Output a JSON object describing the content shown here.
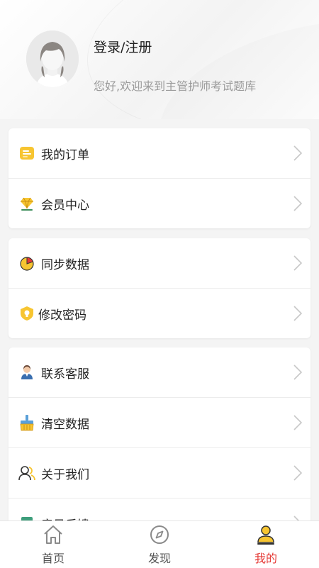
{
  "profile": {
    "login_label": "登录/注册",
    "welcome_text": "您好,欢迎来到主管护师考试题库"
  },
  "menu_groups": [
    {
      "items": [
        {
          "label": "我的订单",
          "icon": "order-icon"
        },
        {
          "label": "会员中心",
          "icon": "diamond-icon"
        }
      ]
    },
    {
      "items": [
        {
          "label": "同步数据",
          "icon": "sync-pie-icon"
        },
        {
          "label": "修改密码",
          "icon": "password-bulb-icon"
        }
      ]
    },
    {
      "items": [
        {
          "label": "联系客服",
          "icon": "customer-service-icon"
        },
        {
          "label": "清空数据",
          "icon": "clear-data-icon"
        },
        {
          "label": "关于我们",
          "icon": "about-us-icon"
        },
        {
          "label": "意见反馈",
          "icon": "feedback-icon"
        }
      ]
    }
  ],
  "tabbar": {
    "tabs": [
      {
        "label": "首页",
        "icon": "home-icon",
        "active": false
      },
      {
        "label": "发现",
        "icon": "compass-icon",
        "active": false
      },
      {
        "label": "我的",
        "icon": "user-icon",
        "active": true
      }
    ]
  },
  "colors": {
    "accent": "#e53935",
    "icon_yellow": "#f7c531",
    "muted_text": "#9a9a9a"
  }
}
